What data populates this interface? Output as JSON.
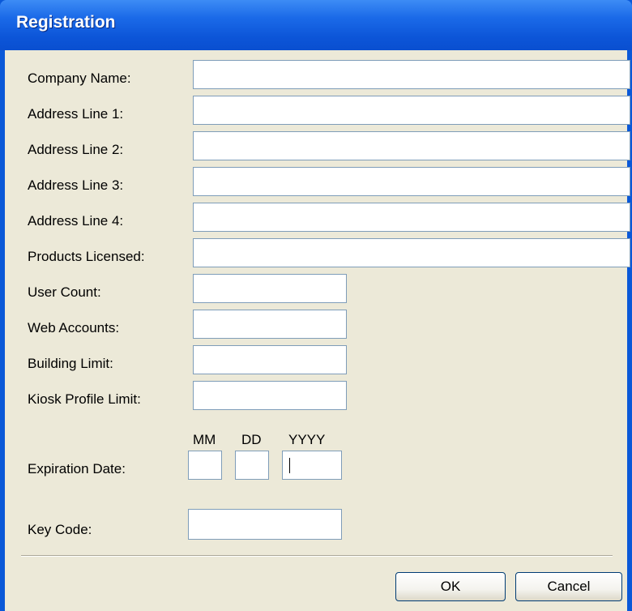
{
  "window": {
    "title": "Registration"
  },
  "fields": {
    "company_name": {
      "label": "Company Name:",
      "value": ""
    },
    "address_line_1": {
      "label": "Address Line 1:",
      "value": ""
    },
    "address_line_2": {
      "label": "Address Line 2:",
      "value": ""
    },
    "address_line_3": {
      "label": "Address Line 3:",
      "value": ""
    },
    "address_line_4": {
      "label": "Address Line 4:",
      "value": ""
    },
    "products_licensed": {
      "label": "Products Licensed:",
      "value": ""
    },
    "user_count": {
      "label": "User Count:",
      "value": ""
    },
    "web_accounts": {
      "label": "Web Accounts:",
      "value": ""
    },
    "building_limit": {
      "label": "Building Limit:",
      "value": ""
    },
    "kiosk_profile_limit": {
      "label": "Kiosk Profile Limit:",
      "value": ""
    }
  },
  "expiration": {
    "label": "Expiration Date:",
    "mm_header": "MM",
    "dd_header": "DD",
    "yyyy_header": "YYYY",
    "mm_value": "",
    "dd_value": "",
    "yyyy_value": ""
  },
  "key_code": {
    "label": "Key Code:",
    "value": ""
  },
  "buttons": {
    "ok_label": "OK",
    "cancel_label": "Cancel"
  },
  "colors": {
    "title_bar": "#0c55d8",
    "dialog_background": "#ece9d8",
    "field_border": "#7f9db9",
    "button_border": "#003c74"
  }
}
